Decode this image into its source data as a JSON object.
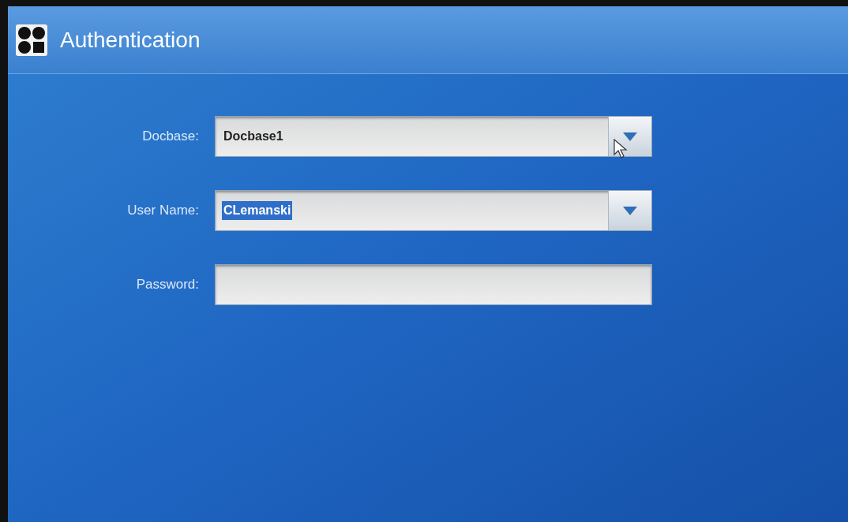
{
  "window": {
    "title": "Authentication"
  },
  "fields": [
    {
      "label": "Docbase:",
      "kind": "dropdown",
      "value": "Docbase1",
      "value_selected": false,
      "pointer_over": true
    },
    {
      "label": "User Name:",
      "kind": "dropdown",
      "value": "CLemanski",
      "value_selected": true,
      "pointer_over": false
    },
    {
      "label": "Password:",
      "kind": "password",
      "pointer_over": false
    }
  ]
}
